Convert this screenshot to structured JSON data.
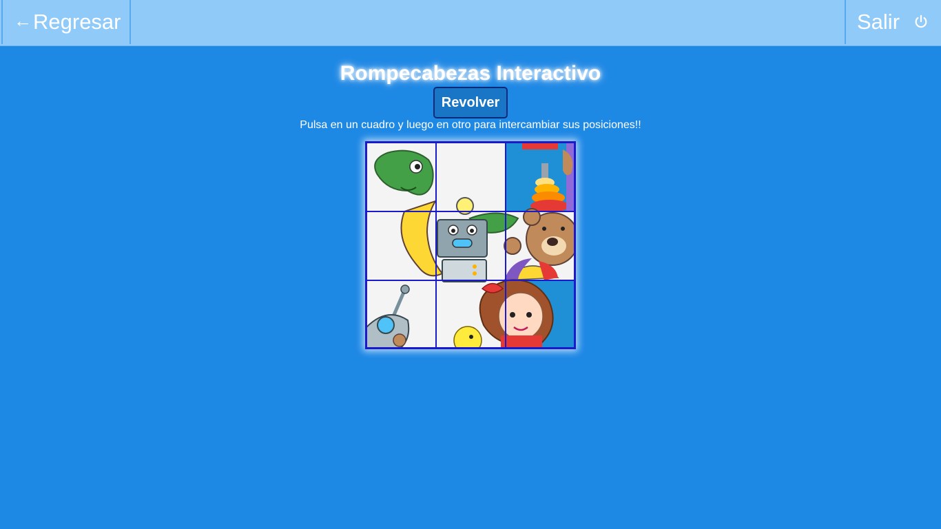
{
  "header": {
    "back_arrow": "←",
    "back_label": "Regresar",
    "exit_label": "Salir",
    "exit_icon": "power-icon"
  },
  "main": {
    "title": "Rompecabezas Interactivo",
    "shuffle_label": "Revolver",
    "instructions": "Pulsa en un cuadro y luego en otro para intercambiar sus posiciones!!"
  },
  "puzzle": {
    "rows": 3,
    "cols": 3,
    "border_color": "#1a1acc",
    "illustration": [
      "dinosaur",
      "robot",
      "teddy-bear",
      "stacking-rings",
      "doll",
      "beach-ball",
      "duck",
      "robot-arm"
    ]
  },
  "colors": {
    "background": "#1e88e5",
    "topbar": "#90caf9",
    "button": "#1976c7"
  }
}
